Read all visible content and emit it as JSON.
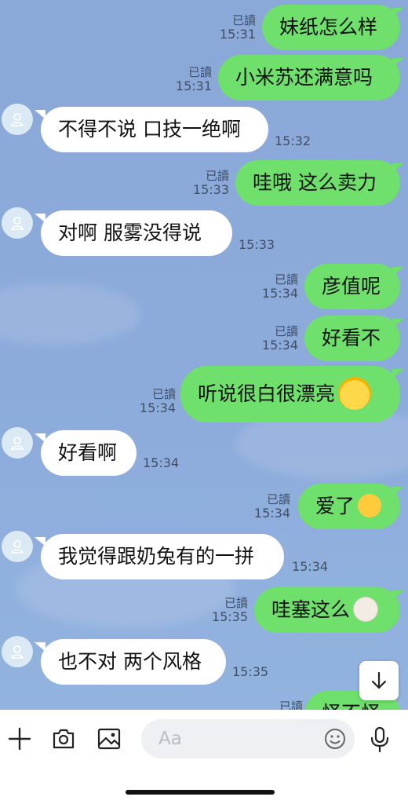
{
  "messages": [
    {
      "text": "妹纸怎么样",
      "read": "已讀",
      "time": "15:31"
    },
    {
      "text": "小米苏还满意吗",
      "read": "已讀",
      "time": "15:31"
    },
    {
      "text": "不得不说 口技一绝啊",
      "time": "15:32"
    },
    {
      "text": "哇哦 这么卖力",
      "read": "已讀",
      "time": "15:33"
    },
    {
      "text": "对啊 服雾没得说",
      "time": "15:33"
    },
    {
      "text": "彦值呢",
      "read": "已讀",
      "time": "15:34"
    },
    {
      "text": "好看不",
      "read": "已讀",
      "time": "15:34"
    },
    {
      "text": "听说很白很漂亮",
      "read": "已讀",
      "time": "15:34"
    },
    {
      "text": "好看啊",
      "time": "15:34"
    },
    {
      "text": "爱了",
      "read": "已讀",
      "time": "15:34"
    },
    {
      "text": "我觉得跟奶兔有的一拼",
      "time": "15:34"
    },
    {
      "text": "哇塞这么",
      "read": "已讀",
      "time": "15:35"
    },
    {
      "text": "也不对 两个风格",
      "time": "15:35"
    },
    {
      "text": "怪不怪",
      "read": "已讀"
    }
  ],
  "input": {
    "placeholder": "Aa"
  },
  "icons": {
    "add": "plus-icon",
    "camera": "camera-icon",
    "image": "image-icon",
    "emoji": "smiley-icon",
    "mic": "microphone-icon",
    "scroll": "arrow-down-icon",
    "avatar": "person-icon"
  },
  "colors": {
    "background": "#8ba9d9",
    "outgoing_bubble": "#6ee06b",
    "incoming_bubble": "#ffffff"
  }
}
